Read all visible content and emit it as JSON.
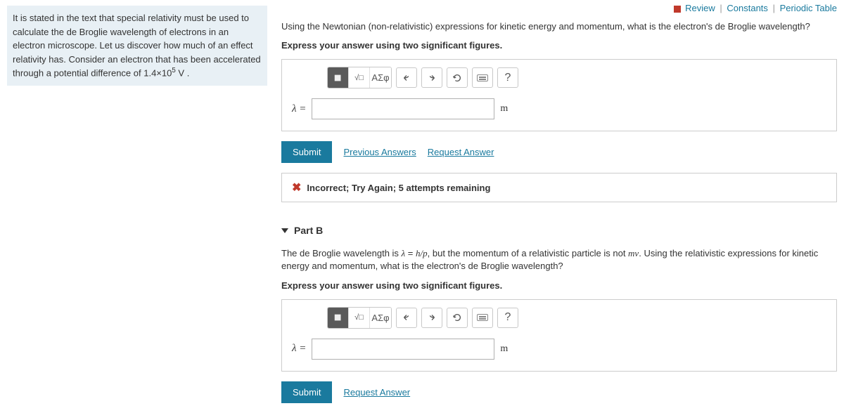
{
  "topLinks": {
    "review": "Review",
    "constants": "Constants",
    "periodic": "Periodic Table"
  },
  "intro": {
    "text_before_exp": "It is stated in the text that special relativity must be used to calculate the de Broglie wavelength of electrons in an electron microscope. Let us discover how much of an effect relativity has. Consider an electron that has been accelerated through a potential difference of 1.4×10",
    "exp": "5",
    "unit": " V ."
  },
  "partA": {
    "question": "Using the Newtonian (non-relativistic) expressions for kinetic energy and momentum, what is the electron's de Broglie wavelength?",
    "instruction": "Express your answer using two significant figures.",
    "lambdaLabel": "λ =",
    "unit": "m",
    "submit": "Submit",
    "prevAnswers": "Previous Answers",
    "requestAnswer": "Request Answer",
    "feedback": "Incorrect; Try Again; 5 attempts remaining",
    "toolbarSymbols": "ΑΣφ"
  },
  "partB": {
    "header": "Part B",
    "q1": "The de Broglie wavelength is ",
    "lambda": "λ",
    "eq": " = ",
    "hp": "h/p",
    "q2": ", but the momentum of a relativistic particle is not ",
    "mv": "mv",
    "q3": ". Using the relativistic expressions for kinetic energy and momentum, what is the electron's de Broglie wavelength?",
    "instruction": "Express your answer using two significant figures.",
    "lambdaLabel": "λ =",
    "unit": "m",
    "submit": "Submit",
    "requestAnswer": "Request Answer",
    "toolbarSymbols": "ΑΣφ"
  }
}
